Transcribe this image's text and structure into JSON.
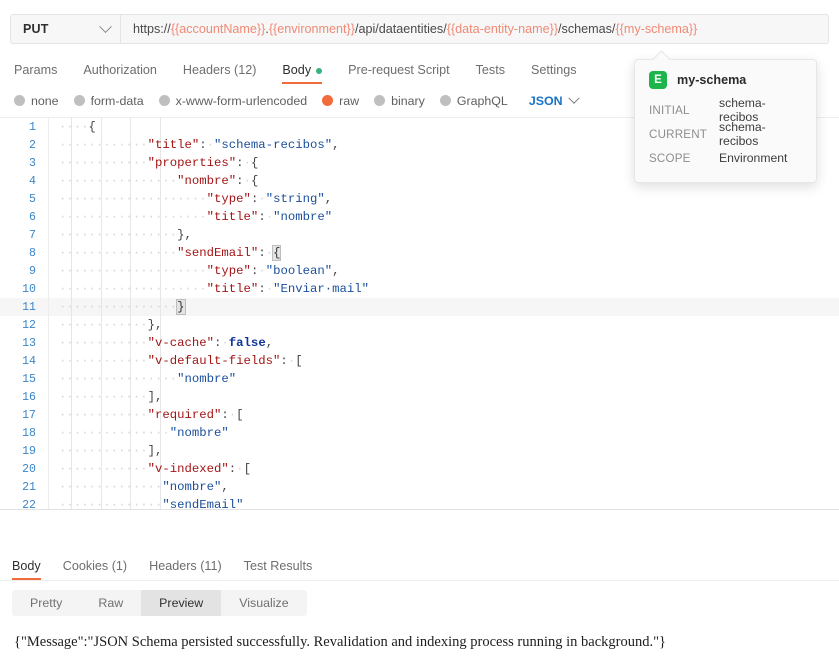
{
  "request": {
    "method": "PUT",
    "url_parts": [
      {
        "text": "https://",
        "var": false
      },
      {
        "text": "{{accountName}}",
        "var": true
      },
      {
        "text": ".",
        "var": false
      },
      {
        "text": "{{environment}}",
        "var": true
      },
      {
        "text": "/api/dataentities/",
        "var": false
      },
      {
        "text": "{{data-entity-name}}",
        "var": true
      },
      {
        "text": "/schemas/",
        "var": false
      },
      {
        "text": "{{my-schema}}",
        "var": true
      }
    ],
    "url_plain": "https://{{accountName}}.{{environment}}/api/dataentities/{{data-entity-name}}/schemas/{{my-schema}}",
    "tabs": [
      {
        "label": "Params",
        "active": false,
        "dot": false
      },
      {
        "label": "Authorization",
        "active": false,
        "dot": false
      },
      {
        "label": "Headers (12)",
        "active": false,
        "dot": false
      },
      {
        "label": "Body",
        "active": true,
        "dot": true
      },
      {
        "label": "Pre-request Script",
        "active": false,
        "dot": false
      },
      {
        "label": "Tests",
        "active": false,
        "dot": false
      },
      {
        "label": "Settings",
        "active": false,
        "dot": false
      }
    ],
    "body_types": [
      {
        "label": "none",
        "selected": false
      },
      {
        "label": "form-data",
        "selected": false
      },
      {
        "label": "x-www-form-urlencoded",
        "selected": false
      },
      {
        "label": "raw",
        "selected": true
      },
      {
        "label": "binary",
        "selected": false
      },
      {
        "label": "GraphQL",
        "selected": false
      }
    ],
    "raw_format": "JSON"
  },
  "tooltip": {
    "badge": "E",
    "name": "my-schema",
    "rows": [
      {
        "key": "INITIAL",
        "value": "schema-recibos"
      },
      {
        "key": "CURRENT",
        "value": "schema-recibos"
      },
      {
        "key": "SCOPE",
        "value": "Environment"
      }
    ]
  },
  "editor": {
    "lines": [
      {
        "n": 1,
        "active": false,
        "tokens": [
          {
            "t": "····",
            "c": "ws"
          },
          {
            "t": "{",
            "c": "p"
          }
        ]
      },
      {
        "n": 2,
        "active": false,
        "tokens": [
          {
            "t": "····",
            "c": "ws"
          },
          {
            "t": "····",
            "c": "ws"
          },
          {
            "t": "····",
            "c": "ws"
          },
          {
            "t": "\"title\"",
            "c": "k"
          },
          {
            "t": ":",
            "c": "p"
          },
          {
            "t": "·",
            "c": "ws"
          },
          {
            "t": "\"schema-recibos\"",
            "c": "s"
          },
          {
            "t": ",",
            "c": "p"
          }
        ]
      },
      {
        "n": 3,
        "active": false,
        "tokens": [
          {
            "t": "····",
            "c": "ws"
          },
          {
            "t": "····",
            "c": "ws"
          },
          {
            "t": "····",
            "c": "ws"
          },
          {
            "t": "\"properties\"",
            "c": "k"
          },
          {
            "t": ":",
            "c": "p"
          },
          {
            "t": "·",
            "c": "ws"
          },
          {
            "t": "{",
            "c": "p"
          }
        ]
      },
      {
        "n": 4,
        "active": false,
        "tokens": [
          {
            "t": "····",
            "c": "ws"
          },
          {
            "t": "····",
            "c": "ws"
          },
          {
            "t": "····",
            "c": "ws"
          },
          {
            "t": "····",
            "c": "ws"
          },
          {
            "t": "\"nombre\"",
            "c": "k"
          },
          {
            "t": ":",
            "c": "p"
          },
          {
            "t": "·",
            "c": "ws"
          },
          {
            "t": "{",
            "c": "p"
          }
        ]
      },
      {
        "n": 5,
        "active": false,
        "tokens": [
          {
            "t": "····",
            "c": "ws"
          },
          {
            "t": "····",
            "c": "ws"
          },
          {
            "t": "····",
            "c": "ws"
          },
          {
            "t": "····",
            "c": "ws"
          },
          {
            "t": "····",
            "c": "ws"
          },
          {
            "t": "\"type\"",
            "c": "k"
          },
          {
            "t": ":",
            "c": "p"
          },
          {
            "t": "·",
            "c": "ws"
          },
          {
            "t": "\"string\"",
            "c": "s"
          },
          {
            "t": ",",
            "c": "p"
          }
        ]
      },
      {
        "n": 6,
        "active": false,
        "tokens": [
          {
            "t": "····",
            "c": "ws"
          },
          {
            "t": "····",
            "c": "ws"
          },
          {
            "t": "····",
            "c": "ws"
          },
          {
            "t": "····",
            "c": "ws"
          },
          {
            "t": "····",
            "c": "ws"
          },
          {
            "t": "\"title\"",
            "c": "k"
          },
          {
            "t": ":",
            "c": "p"
          },
          {
            "t": "·",
            "c": "ws"
          },
          {
            "t": "\"nombre\"",
            "c": "s"
          }
        ]
      },
      {
        "n": 7,
        "active": false,
        "tokens": [
          {
            "t": "····",
            "c": "ws"
          },
          {
            "t": "····",
            "c": "ws"
          },
          {
            "t": "····",
            "c": "ws"
          },
          {
            "t": "····",
            "c": "ws"
          },
          {
            "t": "}",
            "c": "p"
          },
          {
            "t": ",",
            "c": "p"
          }
        ]
      },
      {
        "n": 8,
        "active": false,
        "tokens": [
          {
            "t": "····",
            "c": "ws"
          },
          {
            "t": "····",
            "c": "ws"
          },
          {
            "t": "····",
            "c": "ws"
          },
          {
            "t": "····",
            "c": "ws"
          },
          {
            "t": "\"sendEmail\"",
            "c": "k"
          },
          {
            "t": ":",
            "c": "p"
          },
          {
            "t": "·",
            "c": "ws"
          },
          {
            "t": "{",
            "c": "match"
          }
        ]
      },
      {
        "n": 9,
        "active": false,
        "tokens": [
          {
            "t": "····",
            "c": "ws"
          },
          {
            "t": "····",
            "c": "ws"
          },
          {
            "t": "····",
            "c": "ws"
          },
          {
            "t": "····",
            "c": "ws"
          },
          {
            "t": "····",
            "c": "ws"
          },
          {
            "t": "\"type\"",
            "c": "k"
          },
          {
            "t": ":",
            "c": "p"
          },
          {
            "t": "·",
            "c": "ws"
          },
          {
            "t": "\"boolean\"",
            "c": "s"
          },
          {
            "t": ",",
            "c": "p"
          }
        ]
      },
      {
        "n": 10,
        "active": false,
        "tokens": [
          {
            "t": "····",
            "c": "ws"
          },
          {
            "t": "····",
            "c": "ws"
          },
          {
            "t": "····",
            "c": "ws"
          },
          {
            "t": "····",
            "c": "ws"
          },
          {
            "t": "····",
            "c": "ws"
          },
          {
            "t": "\"title\"",
            "c": "k"
          },
          {
            "t": ":",
            "c": "p"
          },
          {
            "t": "·",
            "c": "ws"
          },
          {
            "t": "\"Enviar·mail\"",
            "c": "s"
          }
        ]
      },
      {
        "n": 11,
        "active": true,
        "tokens": [
          {
            "t": "····",
            "c": "ws"
          },
          {
            "t": "····",
            "c": "ws"
          },
          {
            "t": "····",
            "c": "ws"
          },
          {
            "t": "····",
            "c": "ws"
          },
          {
            "t": "}",
            "c": "match"
          }
        ]
      },
      {
        "n": 12,
        "active": false,
        "tokens": [
          {
            "t": "····",
            "c": "ws"
          },
          {
            "t": "····",
            "c": "ws"
          },
          {
            "t": "····",
            "c": "ws"
          },
          {
            "t": "}",
            "c": "p"
          },
          {
            "t": ",",
            "c": "p"
          }
        ]
      },
      {
        "n": 13,
        "active": false,
        "tokens": [
          {
            "t": "····",
            "c": "ws"
          },
          {
            "t": "····",
            "c": "ws"
          },
          {
            "t": "····",
            "c": "ws"
          },
          {
            "t": "\"v-cache\"",
            "c": "k"
          },
          {
            "t": ":",
            "c": "p"
          },
          {
            "t": "·",
            "c": "ws"
          },
          {
            "t": "false",
            "c": "b"
          },
          {
            "t": ",",
            "c": "p"
          }
        ]
      },
      {
        "n": 14,
        "active": false,
        "tokens": [
          {
            "t": "····",
            "c": "ws"
          },
          {
            "t": "····",
            "c": "ws"
          },
          {
            "t": "····",
            "c": "ws"
          },
          {
            "t": "\"v-default-fields\"",
            "c": "k"
          },
          {
            "t": ":",
            "c": "p"
          },
          {
            "t": "·",
            "c": "ws"
          },
          {
            "t": "[",
            "c": "p"
          }
        ]
      },
      {
        "n": 15,
        "active": false,
        "tokens": [
          {
            "t": "····",
            "c": "ws"
          },
          {
            "t": "····",
            "c": "ws"
          },
          {
            "t": "····",
            "c": "ws"
          },
          {
            "t": "····",
            "c": "ws"
          },
          {
            "t": "\"nombre\"",
            "c": "s"
          }
        ]
      },
      {
        "n": 16,
        "active": false,
        "tokens": [
          {
            "t": "····",
            "c": "ws"
          },
          {
            "t": "····",
            "c": "ws"
          },
          {
            "t": "····",
            "c": "ws"
          },
          {
            "t": "]",
            "c": "p"
          },
          {
            "t": ",",
            "c": "p"
          }
        ]
      },
      {
        "n": 17,
        "active": false,
        "tokens": [
          {
            "t": "····",
            "c": "ws"
          },
          {
            "t": "····",
            "c": "ws"
          },
          {
            "t": "····",
            "c": "ws"
          },
          {
            "t": "\"required\"",
            "c": "k"
          },
          {
            "t": ":",
            "c": "p"
          },
          {
            "t": "·",
            "c": "ws"
          },
          {
            "t": "[",
            "c": "p"
          }
        ]
      },
      {
        "n": 18,
        "active": false,
        "tokens": [
          {
            "t": "····",
            "c": "ws"
          },
          {
            "t": "····",
            "c": "ws"
          },
          {
            "t": "····",
            "c": "ws"
          },
          {
            "t": "···",
            "c": "ws"
          },
          {
            "t": "\"nombre\"",
            "c": "s"
          }
        ]
      },
      {
        "n": 19,
        "active": false,
        "tokens": [
          {
            "t": "····",
            "c": "ws"
          },
          {
            "t": "····",
            "c": "ws"
          },
          {
            "t": "····",
            "c": "ws"
          },
          {
            "t": "]",
            "c": "p"
          },
          {
            "t": ",",
            "c": "p"
          }
        ]
      },
      {
        "n": 20,
        "active": false,
        "tokens": [
          {
            "t": "····",
            "c": "ws"
          },
          {
            "t": "····",
            "c": "ws"
          },
          {
            "t": "····",
            "c": "ws"
          },
          {
            "t": "\"v-indexed\"",
            "c": "k"
          },
          {
            "t": ":",
            "c": "p"
          },
          {
            "t": "·",
            "c": "ws"
          },
          {
            "t": "[",
            "c": "p"
          }
        ]
      },
      {
        "n": 21,
        "active": false,
        "tokens": [
          {
            "t": "····",
            "c": "ws"
          },
          {
            "t": "····",
            "c": "ws"
          },
          {
            "t": "····",
            "c": "ws"
          },
          {
            "t": "··",
            "c": "ws"
          },
          {
            "t": "\"nombre\"",
            "c": "s"
          },
          {
            "t": ",",
            "c": "p"
          }
        ]
      },
      {
        "n": 22,
        "active": false,
        "tokens": [
          {
            "t": "····",
            "c": "ws"
          },
          {
            "t": "····",
            "c": "ws"
          },
          {
            "t": "····",
            "c": "ws"
          },
          {
            "t": "··",
            "c": "ws"
          },
          {
            "t": "\"sendEmail\"",
            "c": "s"
          }
        ]
      }
    ]
  },
  "response": {
    "tabs": [
      {
        "label": "Body",
        "active": true
      },
      {
        "label": "Cookies (1)",
        "active": false
      },
      {
        "label": "Headers (11)",
        "active": false
      },
      {
        "label": "Test Results",
        "active": false
      }
    ],
    "view_modes": [
      {
        "label": "Pretty",
        "active": false
      },
      {
        "label": "Raw",
        "active": false
      },
      {
        "label": "Preview",
        "active": true
      },
      {
        "label": "Visualize",
        "active": false
      }
    ],
    "body_text": "{\"Message\":\"JSON Schema persisted successfully. Revalidation and indexing process running in background.\"}"
  }
}
